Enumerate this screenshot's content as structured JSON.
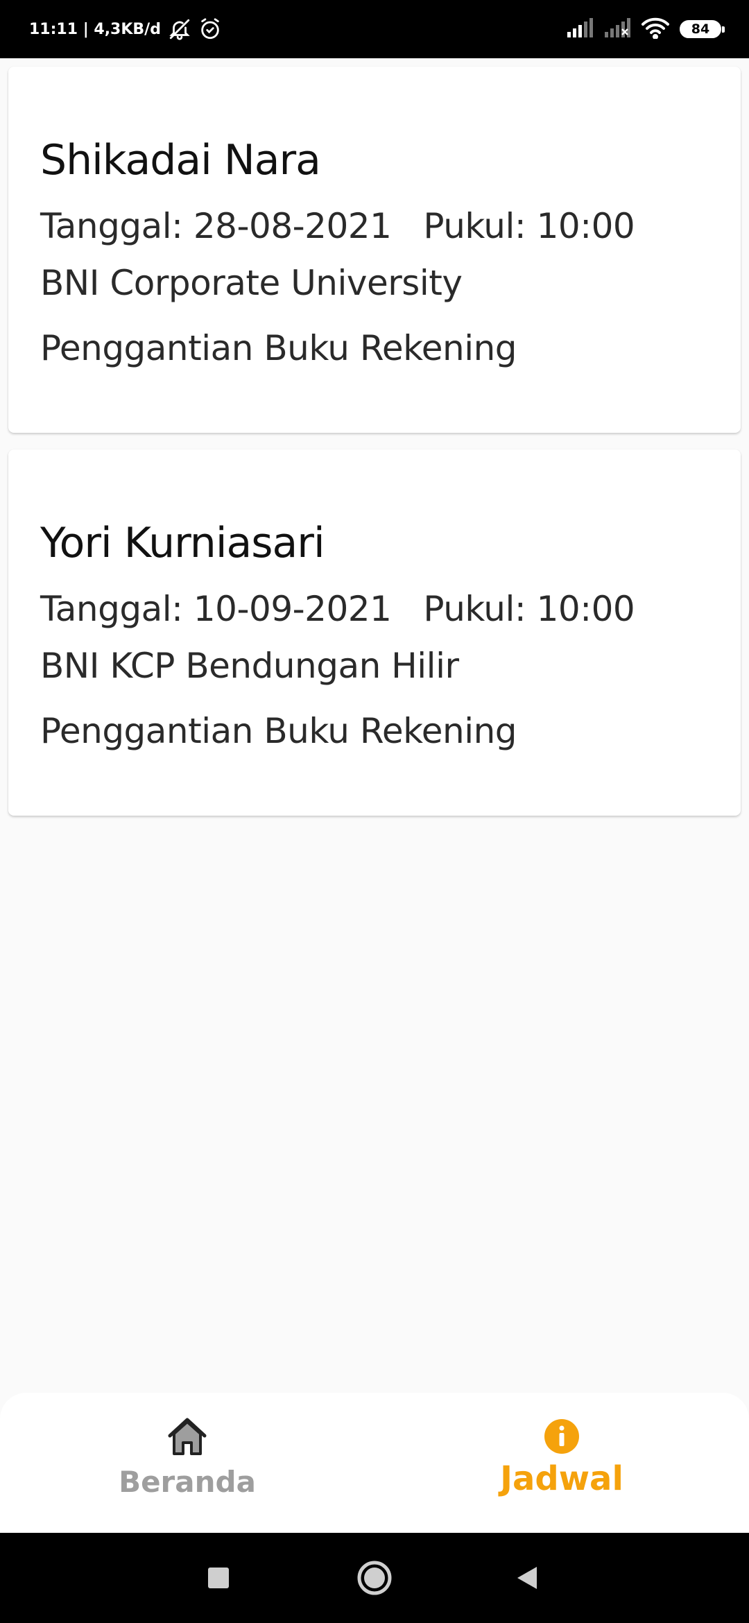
{
  "status_bar": {
    "time": "11:11",
    "network_speed": "4,3KB/d",
    "battery_level": "84",
    "icons": [
      "bell-off-icon",
      "alarm-icon",
      "signal-icon",
      "signal-x-icon",
      "wifi-icon",
      "battery-icon"
    ]
  },
  "appointments": [
    {
      "name": "Shikadai Nara",
      "date_text": "Tanggal: 28-08-2021",
      "time_text": "Pukul: 10:00",
      "location": "BNI Corporate University",
      "service": "Penggantian Buku Rekening"
    },
    {
      "name": "Yori Kurniasari",
      "date_text": "Tanggal: 10-09-2021",
      "time_text": "Pukul: 10:00",
      "location": "BNI KCP Bendungan Hilir",
      "service": "Penggantian Buku Rekening"
    }
  ],
  "bottom_nav": {
    "items": [
      {
        "label": "Beranda",
        "icon": "home-icon",
        "active": false
      },
      {
        "label": "Jadwal",
        "icon": "info-icon",
        "active": true
      }
    ],
    "active_color": "#f5a20c",
    "inactive_color": "#9e9e9e"
  },
  "system_nav": {
    "icons": [
      "recent-apps-icon",
      "home-circle-icon",
      "back-icon"
    ]
  }
}
